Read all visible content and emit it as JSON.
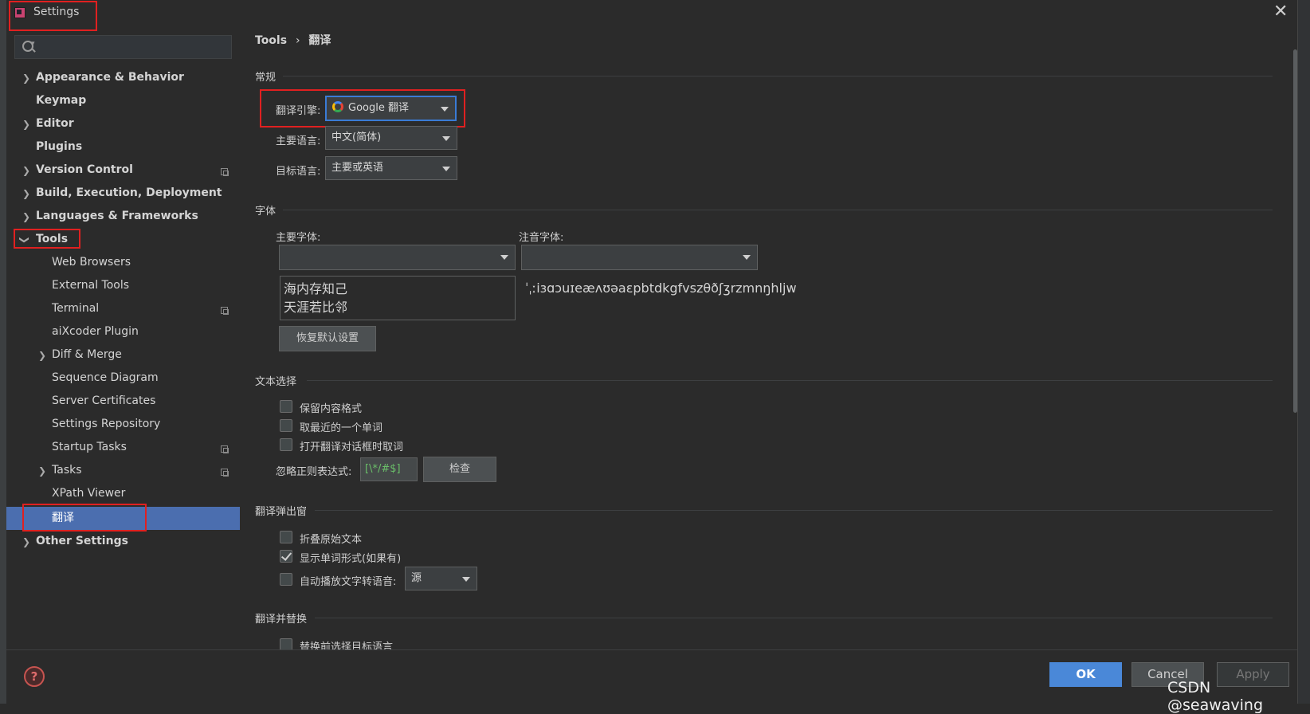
{
  "window": {
    "title": "Settings"
  },
  "search": {
    "placeholder": ""
  },
  "sidebar": {
    "items": [
      {
        "label": "Appearance & Behavior"
      },
      {
        "label": "Keymap"
      },
      {
        "label": "Editor"
      },
      {
        "label": "Plugins"
      },
      {
        "label": "Version Control"
      },
      {
        "label": "Build, Execution, Deployment"
      },
      {
        "label": "Languages & Frameworks"
      },
      {
        "label": "Tools"
      },
      {
        "label": "Web Browsers"
      },
      {
        "label": "External Tools"
      },
      {
        "label": "Terminal"
      },
      {
        "label": "aiXcoder Plugin"
      },
      {
        "label": "Diff & Merge"
      },
      {
        "label": "Sequence Diagram"
      },
      {
        "label": "Server Certificates"
      },
      {
        "label": "Settings Repository"
      },
      {
        "label": "Startup Tasks"
      },
      {
        "label": "Tasks"
      },
      {
        "label": "XPath Viewer"
      },
      {
        "label": "翻译"
      },
      {
        "label": "Other Settings"
      }
    ]
  },
  "breadcrumb": {
    "parent": "Tools",
    "separator": "›",
    "current": "翻译"
  },
  "general": {
    "section": "常规",
    "engine_label": "翻译引擎:",
    "engine_value": "Google 翻译",
    "primary_lang_label": "主要语言:",
    "primary_lang_value": "中文(简体)",
    "target_lang_label": "目标语言:",
    "target_lang_value": "主要或英语"
  },
  "fonts": {
    "section": "字体",
    "primary_font_label": "主要字体:",
    "phonetic_font_label": "注音字体:",
    "preview_line1": "海内存知己",
    "preview_line2": "天涯若比邻",
    "phonetic_preview": "ˈˌːiɜɑɔuɪeæʌʊəaɛpbtdkgfvszθðʃʒrzmnŋhljw",
    "reset_button": "恢复默认设置"
  },
  "text_selection": {
    "section": "文本选择",
    "keep_format": "保留内容格式",
    "nearest_word": "取最近的一个单词",
    "take_on_open": "打开翻译对话框时取词",
    "ignore_regex_label": "忽略正则表达式:",
    "ignore_regex_value": "[\\*/#$]",
    "check_button": "检查"
  },
  "popup": {
    "section": "翻译弹出窗",
    "fold_original": "折叠原始文本",
    "show_word_forms": "显示单词形式(如果有)",
    "auto_tts": "自动播放文字转语音:",
    "tts_value": "源"
  },
  "replace": {
    "section": "翻译并替换",
    "select_target_before": "替换前选择目标语言"
  },
  "footer": {
    "ok": "OK",
    "cancel": "Cancel",
    "apply": "Apply",
    "help": "?"
  },
  "watermark": "CSDN @seawaving",
  "colors": {
    "accent": "#4b6eaf",
    "ok_button": "#4a88d8",
    "highlight_box": "#e02020"
  }
}
